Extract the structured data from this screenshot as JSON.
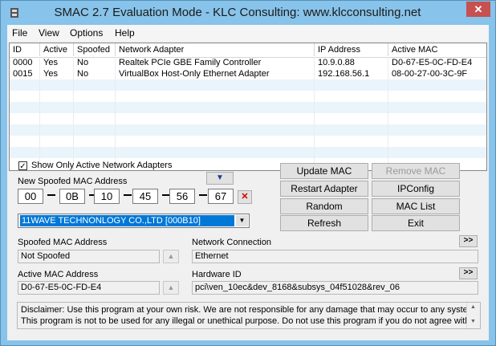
{
  "window": {
    "title": "SMAC 2.7   Evaluation Mode  -  KLC Consulting:  www.klcconsulting.net"
  },
  "menu": [
    "File",
    "View",
    "Options",
    "Help"
  ],
  "table": {
    "columns": [
      "ID",
      "Active",
      "Spoofed",
      "Network Adapter",
      "IP Address",
      "Active MAC"
    ],
    "rows": [
      [
        "0000",
        "Yes",
        "No",
        "Realtek PCIe GBE Family Controller",
        "10.9.0.88",
        "D0-67-E5-0C-FD-E4"
      ],
      [
        "0015",
        "Yes",
        "No",
        "VirtualBox Host-Only Ethernet Adapter",
        "192.168.56.1",
        "08-00-27-00-3C-9F"
      ]
    ]
  },
  "controls": {
    "show_active_label": "Show Only Active Network Adapters",
    "show_active_checked": true,
    "new_mac_label": "New Spoofed MAC Address",
    "mac_octets": [
      "00",
      "0B",
      "10",
      "45",
      "56",
      "67"
    ],
    "vendor_selected": "11WAVE TECHNONLOGY CO.,LTD [000B10]",
    "clear_symbol": "✕",
    "down_arrow": "▼"
  },
  "buttons": {
    "update_mac": "Update MAC",
    "remove_mac": "Remove MAC",
    "restart_adapter": "Restart Adapter",
    "ipconfig": "IPConfig",
    "random": "Random",
    "mac_list": "MAC List",
    "refresh": "Refresh",
    "exit": "Exit",
    "more": ">>",
    "up": "▲"
  },
  "info": {
    "spoofed_mac_label": "Spoofed MAC Address",
    "spoofed_mac_value": "Not Spoofed",
    "network_connection_label": "Network Connection",
    "network_connection_value": "Ethernet",
    "active_mac_label": "Active MAC Address",
    "active_mac_value": "D0-67-E5-0C-FD-E4",
    "hardware_id_label": "Hardware ID",
    "hardware_id_value": "pci\\ven_10ec&dev_8168&subsys_04f51028&rev_06"
  },
  "disclaimer": {
    "line1": "Disclaimer: Use this program at your own risk.  We are not responsible for any damage that may occur to any system.",
    "line2": "This program is not to be used for any illegal or unethical purpose.  Do not use this program if you do not agree with"
  },
  "colors": {
    "title_bar": "#87c3ea",
    "selected_vendor": "#0078d7",
    "clear_x": "#d00000",
    "arrow_button_fill": "#1f3d8a"
  }
}
